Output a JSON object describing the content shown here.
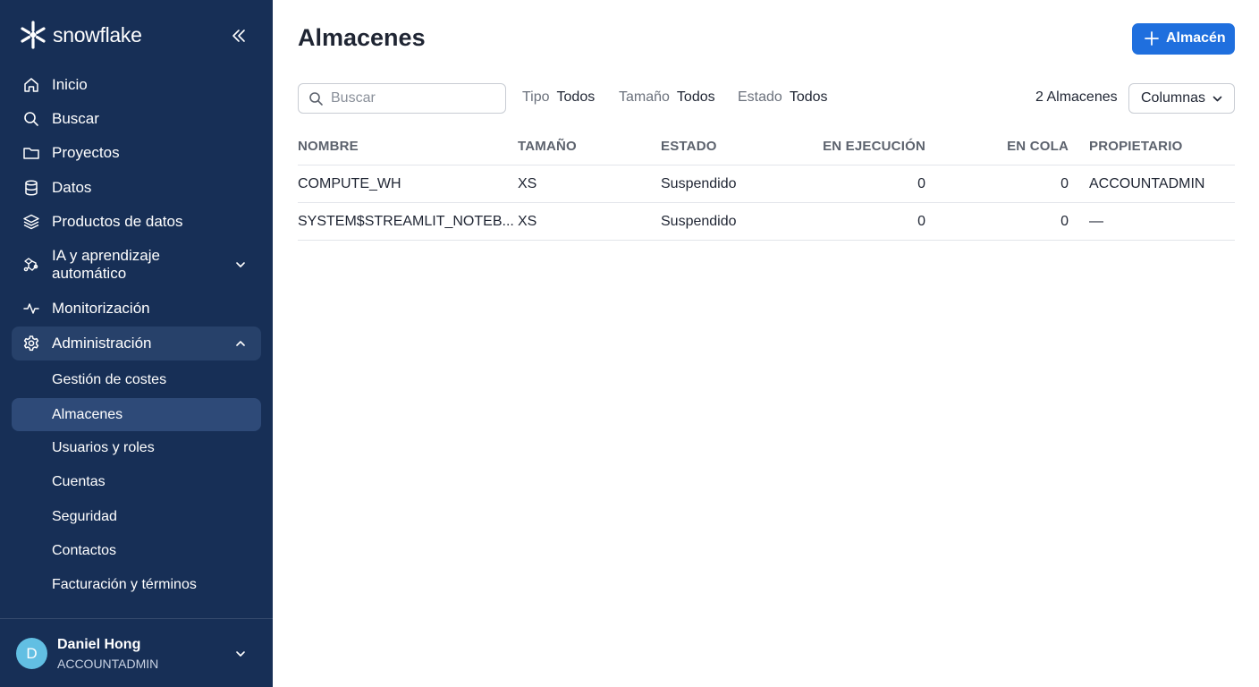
{
  "app": {
    "brand": "snowflake",
    "colors": {
      "sidebar_bg": "#172f56",
      "accent": "#1f6fde",
      "avatar": "#62bfe3"
    }
  },
  "sidebar": {
    "collapse_icon": "double-chevron-left-icon",
    "items": [
      {
        "label": "Inicio",
        "icon": "home-icon"
      },
      {
        "label": "Buscar",
        "icon": "search-icon"
      },
      {
        "label": "Proyectos",
        "icon": "folder-icon"
      },
      {
        "label": "Datos",
        "icon": "database-icon"
      },
      {
        "label": "Productos de datos",
        "icon": "layers-icon"
      },
      {
        "label_line1": "IA y aprendizaje",
        "label_line2": "automático",
        "icon": "ai-icon",
        "expandable": true,
        "expanded": false
      },
      {
        "label": "Monitorización",
        "icon": "activity-icon"
      },
      {
        "label": "Administración",
        "icon": "gear-icon",
        "expandable": true,
        "expanded": true,
        "selected": true
      }
    ],
    "sub_items": [
      {
        "label": "Gestión de costes"
      },
      {
        "label": "Almacenes",
        "active": true
      },
      {
        "label": "Usuarios y roles"
      },
      {
        "label": "Cuentas"
      },
      {
        "label": "Seguridad"
      },
      {
        "label": "Contactos"
      },
      {
        "label": "Facturación y términos"
      }
    ],
    "user": {
      "initial": "D",
      "name": "Daniel Hong",
      "role": "ACCOUNTADMIN"
    }
  },
  "main": {
    "title": "Almacenes",
    "add_button": {
      "label": "Almacén",
      "icon": "plus-icon"
    },
    "search": {
      "placeholder": "Buscar",
      "value": ""
    },
    "filters": [
      {
        "key": "Tipo",
        "value": "Todos"
      },
      {
        "key": "Tamaño",
        "value": "Todos"
      },
      {
        "key": "Estado",
        "value": "Todos"
      }
    ],
    "count_label": "2 Almacenes",
    "columns_button": "Columnas",
    "table": {
      "headers": [
        "NOMBRE",
        "TAMAÑO",
        "ESTADO",
        "EN EJECUCIÓN",
        "EN COLA",
        "PROPIETARIO"
      ],
      "rows": [
        [
          "COMPUTE_WH",
          "XS",
          "Suspendido",
          "0",
          "0",
          "ACCOUNTADMIN"
        ],
        [
          "SYSTEM$STREAMLIT_NOTEB...",
          "XS",
          "Suspendido",
          "0",
          "0",
          "—"
        ]
      ]
    }
  }
}
